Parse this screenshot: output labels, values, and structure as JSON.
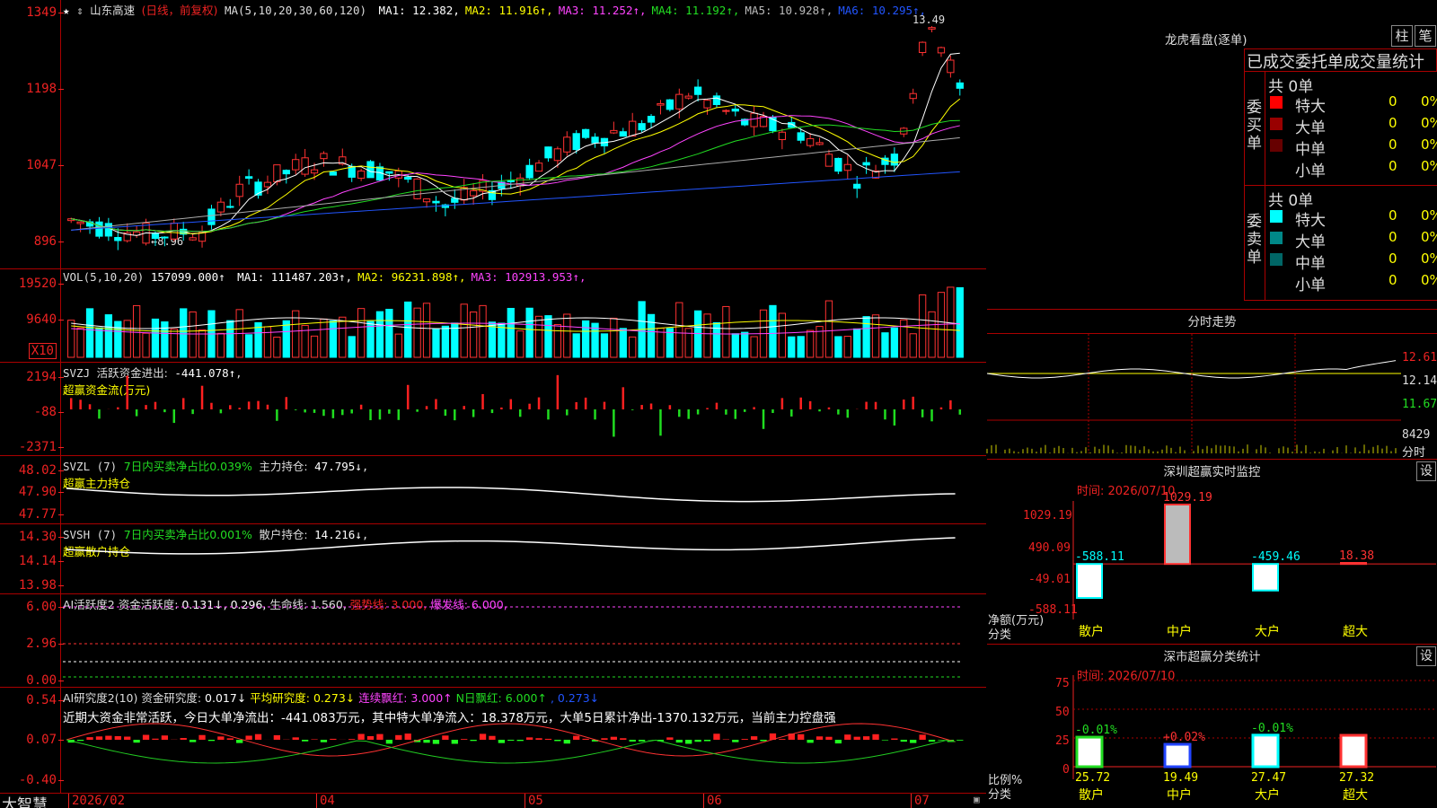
{
  "stock": {
    "name": "山东高速",
    "period": "(日线，前复权)",
    "ma_label": "MA(5,10,20,30,60,120)",
    "ma": [
      {
        "label": "MA1:",
        "value": "12.382",
        "color": "#ffffff"
      },
      {
        "label": "MA2:",
        "value": "11.916↑",
        "color": "#ffff00"
      },
      {
        "label": "MA3:",
        "value": "11.252↑",
        "color": "#ff44ff"
      },
      {
        "label": "MA4:",
        "value": "11.192↑",
        "color": "#22dd22"
      },
      {
        "label": "MA5:",
        "value": "10.928↑",
        "color": "#bbbbbb"
      },
      {
        "label": "MA6:",
        "value": "10.295↑",
        "color": "#2255ff"
      }
    ],
    "high_label": "13.49",
    "low_label": "8.96",
    "price_axis": [
      "1349",
      "1198",
      "1047",
      "896"
    ]
  },
  "volume": {
    "label": "VOL(5,10,20)",
    "value": "157099.000↑",
    "ma": [
      {
        "label": "MA1:",
        "value": "111487.203↑",
        "color": "#ffffff"
      },
      {
        "label": "MA2:",
        "value": "96231.898↑",
        "color": "#ffff00"
      },
      {
        "label": "MA3:",
        "value": "102913.953↑",
        "color": "#ff44ff"
      }
    ],
    "axis": [
      "19520",
      "9640"
    ],
    "unit": "X10"
  },
  "svzj": {
    "label": "SVZJ",
    "text": "活跃资金进出:",
    "value": "-441.078↑",
    "suffix": ",",
    "title": "超赢资金流(万元)",
    "axis": [
      "2194",
      "-88",
      "-2371"
    ]
  },
  "svzl": {
    "label": "SVZL (7)",
    "text": "7日内买卖净占比0.039%",
    "holding": "主力持仓:",
    "value": "47.795↓",
    "suffix": ",",
    "title": "超赢主力持仓",
    "axis": [
      "48.02",
      "47.90",
      "47.77"
    ]
  },
  "svsh": {
    "label": "SVSH (7)",
    "text": "7日内买卖净占比0.001%",
    "holding": "散户持仓:",
    "value": "14.216↓",
    "suffix": ",",
    "title": "超赢散户持仓",
    "axis": [
      "14.30",
      "14.14",
      "13.98"
    ]
  },
  "ai1": {
    "label": "AI活跃度2",
    "text": "资金活跃度:",
    "value1": "0.131↓",
    "value2": ", 0.296,",
    "life": "生命线: 1.560,",
    "strong": "强势线: 3.000,",
    "burst": "爆发线: 6.000,",
    "axis": [
      "6.00",
      "2.96",
      "0.00"
    ]
  },
  "ai2": {
    "label": "AI研究度2(10)",
    "text": "资金研究度:",
    "value": "0.017↓",
    "avg": "平均研究度: 0.273↓",
    "cont": "连续飘红: 3.000↑",
    "nday": "N日飘红: 6.000↑",
    "last": ", 0.273↓",
    "comment": "近期大资金非常活跃，今日大单净流出：-441.083万元，其中特大单净流入：18.378万元，大单5日累计净出-1370.132万元，当前主力控盘强",
    "axis": [
      "0.54",
      "0.07",
      "-0.40"
    ]
  },
  "date_axis": [
    "2026/02",
    "04",
    "05",
    "06",
    "07"
  ],
  "brand": "大智慧",
  "dragon": {
    "title": "龙虎看盘(逐单)",
    "btn_col": "柱",
    "btn_pen": "笔",
    "tabs": "已成交委托单成交量统计",
    "buy_label": "委买单",
    "sell_label": "委卖单",
    "buy_total": "共 0单",
    "sell_total": "共 0单",
    "buy_rows": [
      {
        "label": "特大",
        "count": "0",
        "pct": "0%",
        "color": "#ff0000"
      },
      {
        "label": "大单",
        "count": "0",
        "pct": "0%",
        "color": "#990000"
      },
      {
        "label": "中单",
        "count": "0",
        "pct": "0%",
        "color": "#660000"
      },
      {
        "label": "小单",
        "count": "0",
        "pct": "0%",
        "color": ""
      }
    ],
    "sell_rows": [
      {
        "label": "特大",
        "count": "0",
        "pct": "0%",
        "color": "#00ffff"
      },
      {
        "label": "大单",
        "count": "0",
        "pct": "0%",
        "color": "#008888"
      },
      {
        "label": "中单",
        "count": "0",
        "pct": "0%",
        "color": "#006666"
      },
      {
        "label": "小单",
        "count": "0",
        "pct": "0%",
        "color": ""
      }
    ]
  },
  "intraday": {
    "title": "分时走势",
    "axis": [
      "12.61",
      "12.14",
      "11.67",
      "8429",
      "分时"
    ]
  },
  "monitor": {
    "title": "深圳超赢实时监控",
    "btn": "设",
    "time": "时间: 2026/07/10",
    "axis": [
      "1029.19",
      "490.09",
      "-49.01",
      "-588.11"
    ],
    "ylabel": "净额(万元)",
    "xlabel": "分类",
    "chart_data": {
      "type": "bar",
      "categories": [
        "散户",
        "中户",
        "大户",
        "超大"
      ],
      "values": [
        -588.11,
        1029.19,
        -459.46,
        18.38
      ],
      "labels": [
        "-588.11",
        "1029.19",
        "-459.46",
        "18.38"
      ],
      "ylim": [
        -588.11,
        1029.19
      ]
    }
  },
  "classify": {
    "title": "深市超赢分类统计",
    "btn": "设",
    "time": "时间: 2026/07/10",
    "axis": [
      "75",
      "50",
      "25",
      "0"
    ],
    "ylabel": "比例%",
    "xlabel": "分类",
    "chart_data": {
      "type": "bar",
      "categories": [
        "散户",
        "中户",
        "大户",
        "超大"
      ],
      "values": [
        25.72,
        19.49,
        27.47,
        27.32
      ],
      "changes": [
        "-0.01%",
        "+0.02%",
        "-0.01%",
        ""
      ],
      "labels": [
        "25.72",
        "19.49",
        "27.47",
        "27.32"
      ],
      "ylim": [
        0,
        75
      ]
    }
  }
}
